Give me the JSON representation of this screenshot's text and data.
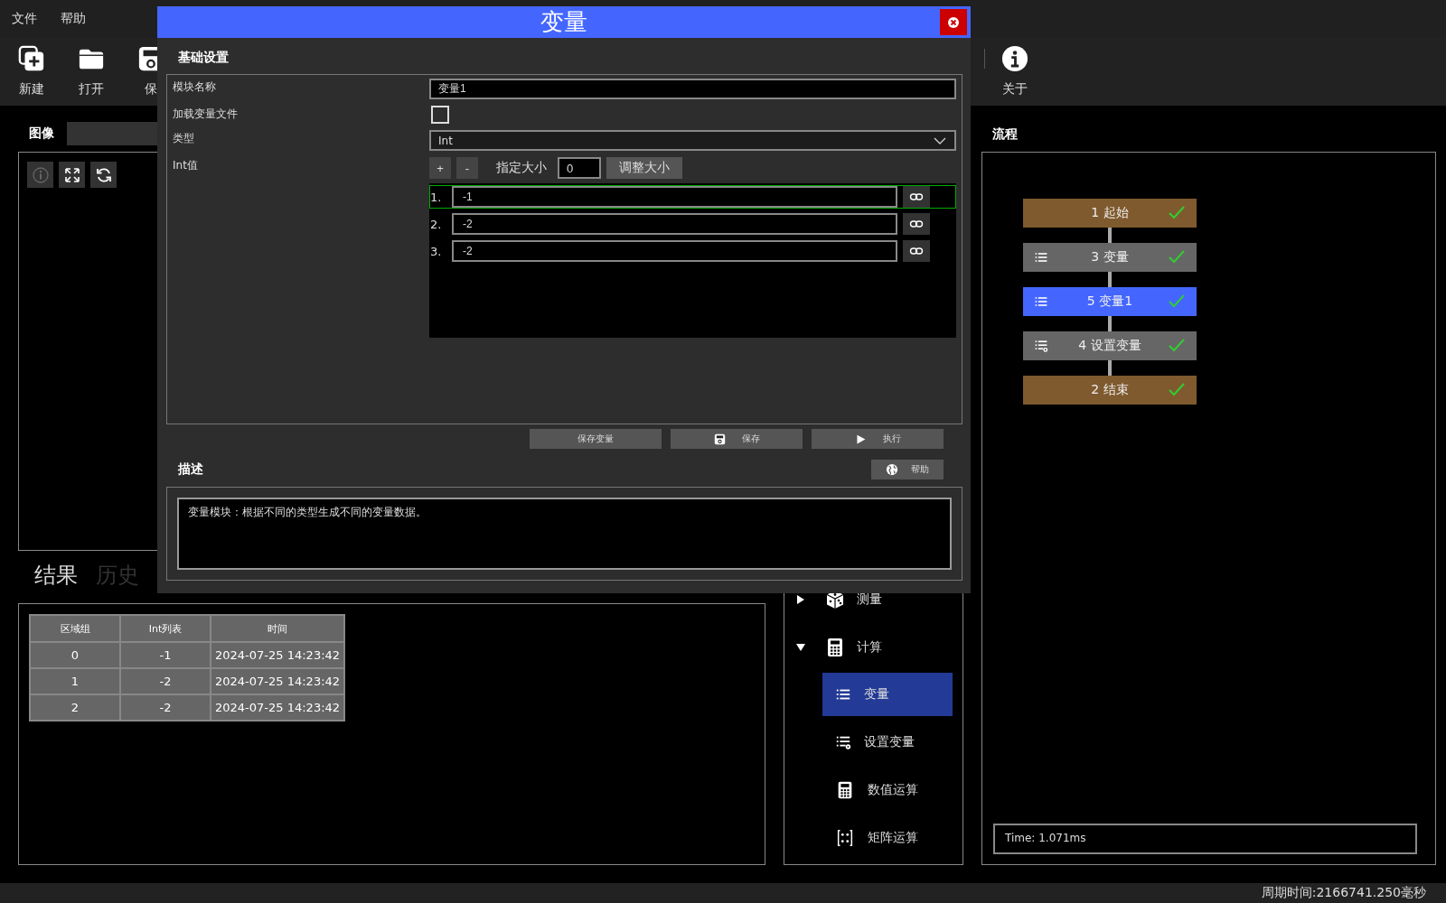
{
  "menu": [
    {
      "label": "文件"
    },
    {
      "label": "帮助"
    }
  ],
  "toolbar": [
    {
      "label": "新建",
      "kind": "new"
    },
    {
      "label": "打开",
      "kind": "open"
    },
    {
      "label": "保",
      "kind": "save"
    },
    {
      "label": "关于",
      "kind": "about"
    }
  ],
  "image_panel": {
    "title": "图像",
    "tools": [
      {
        "kind": "info",
        "disabled": true
      },
      {
        "kind": "fit",
        "disabled": false
      },
      {
        "kind": "refresh",
        "disabled": false
      }
    ]
  },
  "results": {
    "tabs": [
      {
        "label": "结果",
        "selected": true
      },
      {
        "label": "历史",
        "selected": false
      }
    ],
    "table": {
      "columns": [
        "区域组",
        "Int列表",
        "时间"
      ],
      "rows": [
        [
          "0",
          "-1",
          "2024-07-25 14:23:42"
        ],
        [
          "1",
          "-2",
          "2024-07-25 14:23:42"
        ],
        [
          "2",
          "-2",
          "2024-07-25 14:23:42"
        ]
      ]
    }
  },
  "tool_tree": {
    "items": [
      {
        "label": "测量",
        "kind": "dice",
        "expanded": false
      },
      {
        "label": "计算",
        "kind": "calculator",
        "expanded": true,
        "children": [
          {
            "label": "变量",
            "kind": "list",
            "selected": true
          },
          {
            "label": "设置变量",
            "kind": "list-gear",
            "selected": false
          },
          {
            "label": "数值运算",
            "kind": "calculator",
            "selected": false
          },
          {
            "label": "矩阵运算",
            "kind": "matrix",
            "selected": false
          }
        ]
      }
    ]
  },
  "flow": {
    "title": "流程",
    "nodes": [
      {
        "label": "1 起始",
        "kind": "terminal",
        "selected": false,
        "done": true
      },
      {
        "label": "3 变量",
        "kind": "list",
        "selected": false,
        "done": true
      },
      {
        "label": "5 变量1",
        "kind": "list",
        "selected": true,
        "done": true
      },
      {
        "label": "4 设置变量",
        "kind": "list-gear",
        "selected": false,
        "done": true
      },
      {
        "label": "2 结束",
        "kind": "terminal",
        "selected": false,
        "done": true
      }
    ],
    "time": "Time: 1.071ms"
  },
  "dialog": {
    "title": "变量",
    "section": "基础设置",
    "fields": [
      {
        "label": "模块名称",
        "kind": "text",
        "value": "变量1"
      },
      {
        "label": "加载变量文件",
        "kind": "checkbox",
        "checked": false
      },
      {
        "label": "类型",
        "kind": "select",
        "value": "Int"
      },
      {
        "label": "Int值",
        "kind": "list",
        "add": "+",
        "remove": "-",
        "size_label": "指定大小",
        "size_value": "0",
        "resize": "调整大小",
        "items": [
          {
            "index": "1.",
            "value": "-1",
            "selected": true
          },
          {
            "index": "2.",
            "value": "-2",
            "selected": false
          },
          {
            "index": "3.",
            "value": "-2",
            "selected": false
          }
        ]
      }
    ],
    "actions": [
      {
        "label": "保存变量",
        "kind": "plain"
      },
      {
        "label": "保存",
        "kind": "save"
      },
      {
        "label": "执行",
        "kind": "run"
      }
    ],
    "description": {
      "title": "描述",
      "help": "帮助",
      "text": "变量模块：根据不同的类型生成不同的变量数据。"
    }
  },
  "status_bar": "周期时间:2166741.250毫秒"
}
